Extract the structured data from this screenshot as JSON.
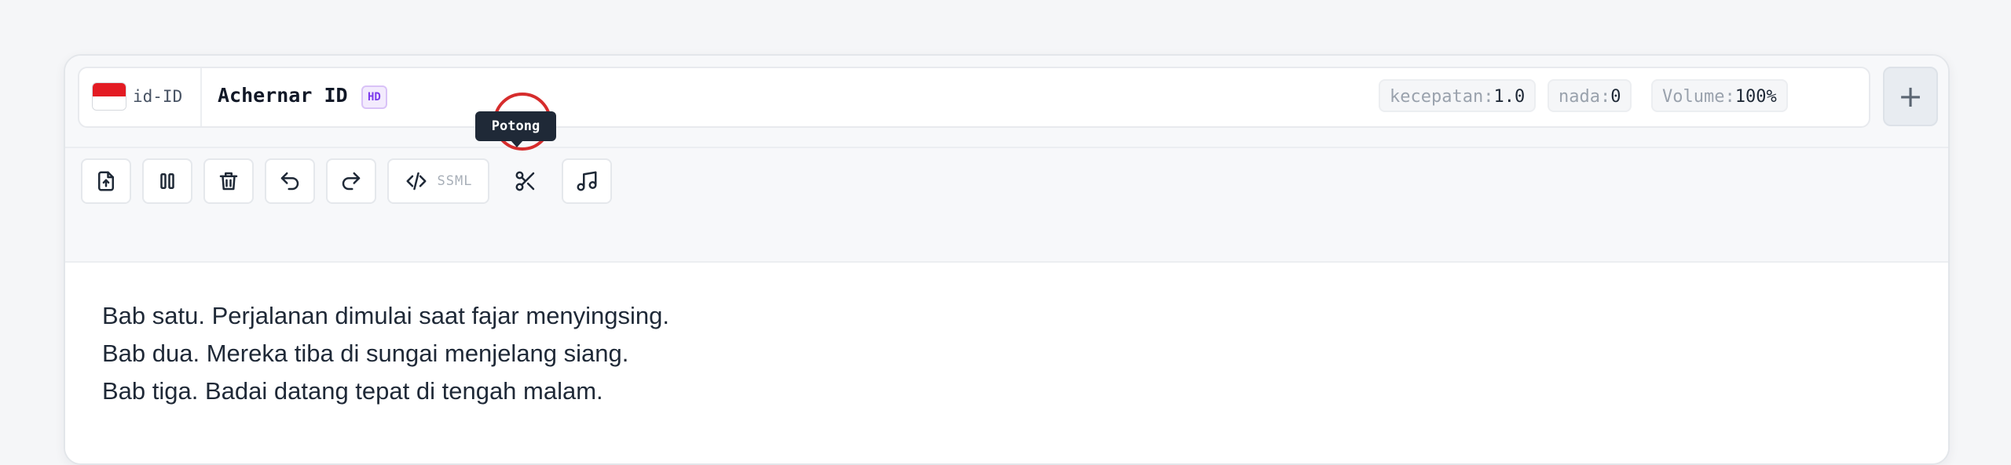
{
  "header": {
    "locale": "id-ID",
    "flag": {
      "name": "indonesia-flag",
      "colors": [
        "#e31b23",
        "#ffffff"
      ]
    },
    "voice_name": "Achernar ID",
    "quality_badge": "HD",
    "params": {
      "speed": {
        "label": "kecepatan:",
        "value": "1.0"
      },
      "pitch": {
        "label": "nada:",
        "value": "0"
      },
      "volume": {
        "label": "Volume:",
        "value": "100%"
      }
    },
    "add_button": "+"
  },
  "toolbar": {
    "buttons": [
      {
        "name": "upload-file",
        "icon": "file-upload-icon"
      },
      {
        "name": "pause",
        "icon": "pause-icon"
      },
      {
        "name": "delete",
        "icon": "trash-icon"
      },
      {
        "name": "undo",
        "icon": "undo-icon"
      },
      {
        "name": "redo",
        "icon": "redo-icon"
      },
      {
        "name": "ssml",
        "icon": "code-icon",
        "label": "SSML"
      },
      {
        "name": "cut",
        "icon": "scissors-icon",
        "tooltip": "Potong"
      },
      {
        "name": "music",
        "icon": "music-note-icon"
      }
    ],
    "tooltip": "Potong"
  },
  "editor": {
    "lines": [
      "Bab satu. Perjalanan dimulai saat fajar menyingsing.",
      "Bab dua. Mereka tiba di sungai menjelang siang.",
      "Bab tiga. Badai datang tepat di tengah malam."
    ]
  },
  "colors": {
    "highlight": "#d62c2c",
    "badge": "#7c3aed",
    "tooltip_bg": "#1f2937"
  }
}
